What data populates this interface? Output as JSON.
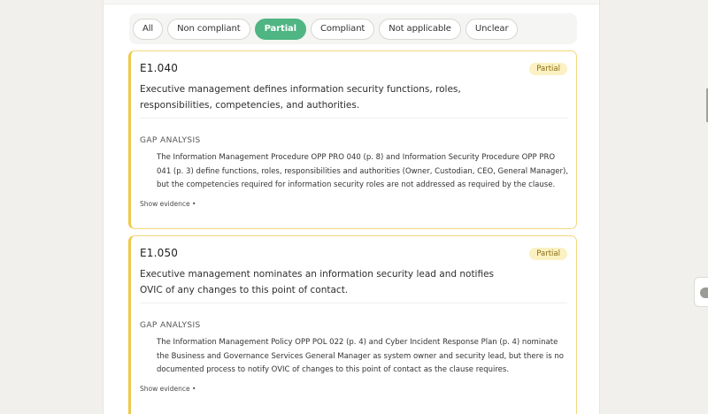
{
  "filters": [
    {
      "label": "All",
      "active": false
    },
    {
      "label": "Non compliant",
      "active": false
    },
    {
      "label": "Partial",
      "active": true
    },
    {
      "label": "Compliant",
      "active": false
    },
    {
      "label": "Not applicable",
      "active": false
    },
    {
      "label": "Unclear",
      "active": false
    }
  ],
  "cards": [
    {
      "id": "E1.040",
      "status": "Partial",
      "description": "Executive management defines information security functions, roles, responsibilities, competencies, and authorities.",
      "gap_heading": "GAP ANALYSIS",
      "gap_text": "The Information Management Procedure OPP PRO 040 (p. 8) and Information Security Procedure OPP PRO 041 (p. 3) define functions, roles, responsibilities and authorities (Owner, Custodian, CEO, General Manager), but the competencies required for information security roles are not addressed as required by the clause.",
      "evidence_label": "Show evidence •"
    },
    {
      "id": "E1.050",
      "status": "Partial",
      "description": "Executive management nominates an information security lead and notifies OVIC of any changes to this point of contact.",
      "gap_heading": "GAP ANALYSIS",
      "gap_text": "The Information Management Policy OPP POL 022 (p. 4) and Cyber Incident Response Plan (p. 4) nominate the Business and Governance Services General Manager as system owner and security lead, but there is no documented process to notify OVIC of changes to this point of contact as the clause requires.",
      "evidence_label": "Show evidence •"
    }
  ],
  "colors": {
    "accent_green": "#4fb583",
    "partial_border": "#efc84a",
    "partial_badge_bg": "#fbf1c2"
  }
}
